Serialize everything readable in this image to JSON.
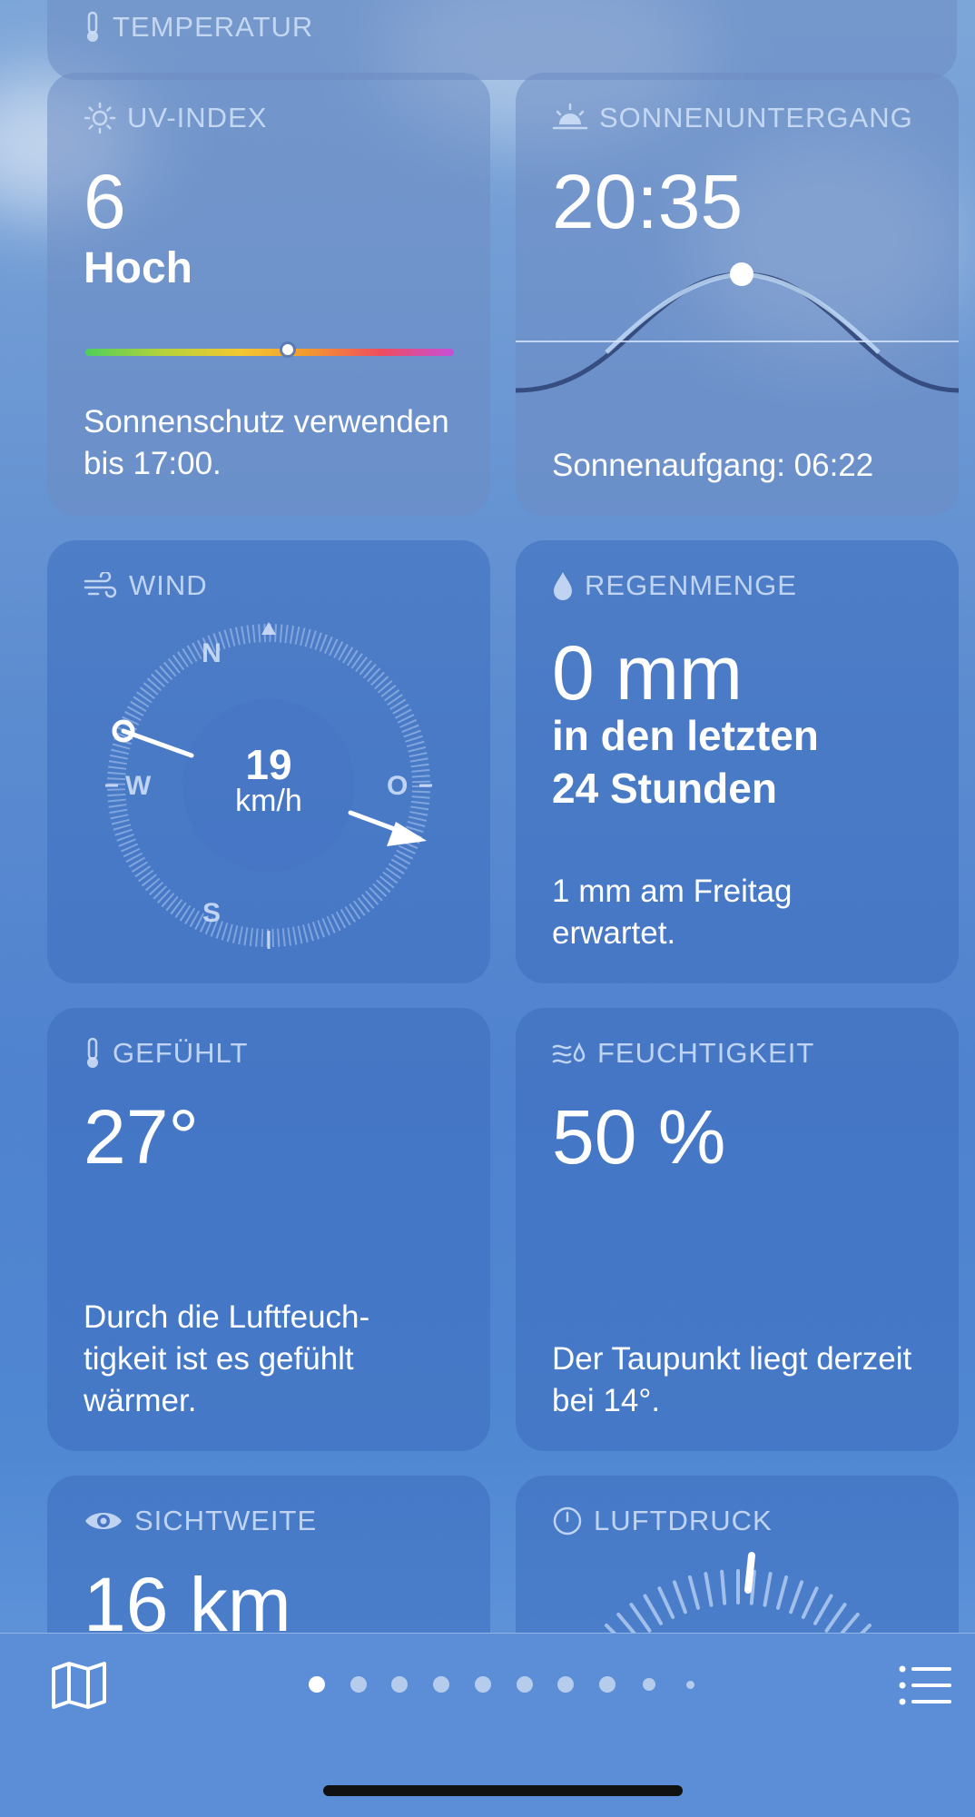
{
  "temperature": {
    "title": "TEMPERATUR"
  },
  "uv": {
    "title": "UV-INDEX",
    "value": "6",
    "level": "Hoch",
    "position_fraction": 0.55,
    "description": "Sonnenschutz verwenden bis 17:00."
  },
  "sunset": {
    "title": "SONNENUNTERGANG",
    "time": "20:35",
    "sunrise": "Sonnenaufgang: 06:22"
  },
  "wind": {
    "title": "WIND",
    "speed": "19",
    "unit": "km/h",
    "north": "N",
    "west": "W",
    "east": "O",
    "south": "S"
  },
  "rain": {
    "title": "REGENMENGE",
    "amount": "0 mm",
    "period_line1": "in den letzten",
    "period_line2": "24 Stunden",
    "forecast": "1 mm am Freitag erwartet."
  },
  "feels_like": {
    "title": "GEFÜHLT",
    "value": "27°",
    "description": "Durch die Luftfeuch-tigkeit ist es gefühlt wärmer."
  },
  "humidity": {
    "title": "FEUCHTIGKEIT",
    "value": "50 %",
    "description": "Der Taupunkt liegt derzeit bei 14°."
  },
  "visibility": {
    "title": "SICHTWEITE",
    "value": "16 km"
  },
  "pressure": {
    "title": "LUFTDRUCK"
  },
  "tabbar": {
    "page_count": 10,
    "active_page": 1,
    "map_icon": "map-icon",
    "list_icon": "list-icon"
  }
}
